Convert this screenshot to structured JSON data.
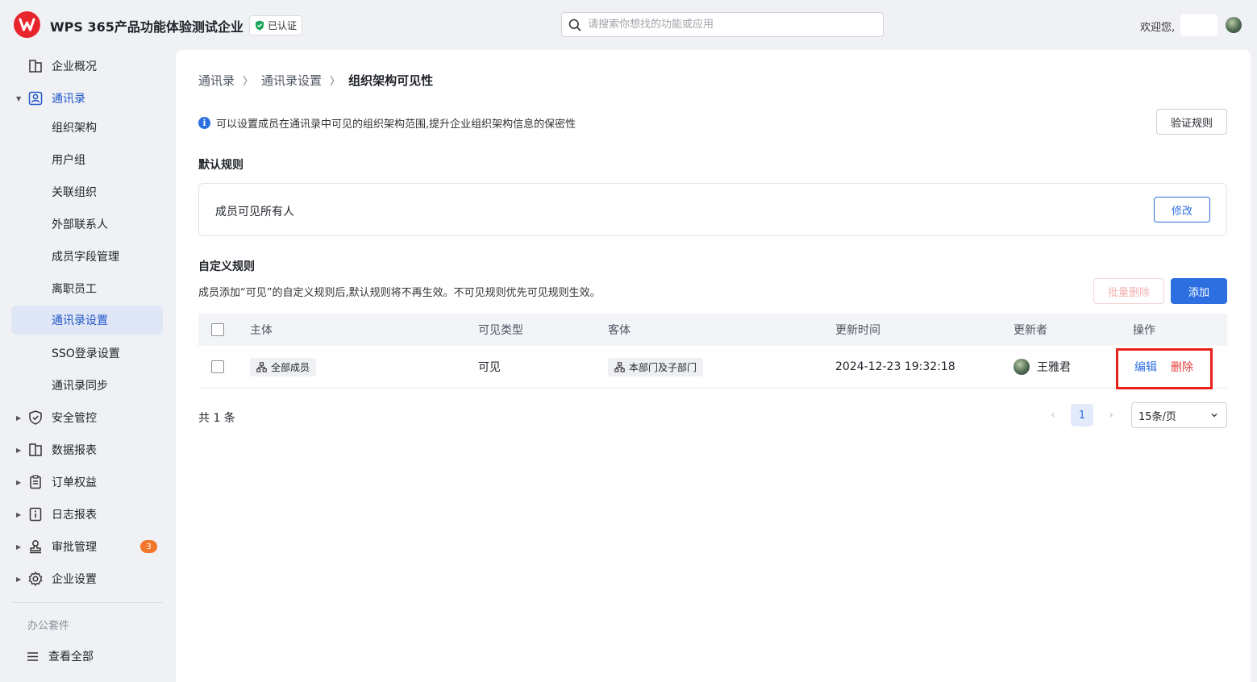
{
  "header": {
    "org_name": "WPS 365产品功能体验测试企业",
    "verified_label": "已认证",
    "search_placeholder": "请搜索你想找的功能或应用",
    "welcome": "欢迎您,"
  },
  "sidebar": {
    "items": [
      {
        "label": "企业概况",
        "icon": "building-icon"
      },
      {
        "label": "通讯录",
        "icon": "contacts-icon"
      },
      {
        "label": "组织架构"
      },
      {
        "label": "用户组"
      },
      {
        "label": "关联组织"
      },
      {
        "label": "外部联系人"
      },
      {
        "label": "成员字段管理"
      },
      {
        "label": "离职员工"
      },
      {
        "label": "通讯录设置"
      },
      {
        "label": "SSO登录设置"
      },
      {
        "label": "通讯录同步"
      },
      {
        "label": "安全管控",
        "icon": "shield-icon"
      },
      {
        "label": "数据报表",
        "icon": "book-icon"
      },
      {
        "label": "订单权益",
        "icon": "clipboard-icon"
      },
      {
        "label": "日志报表",
        "icon": "info-doc-icon"
      },
      {
        "label": "审批管理",
        "icon": "stamp-icon",
        "badge": "3"
      },
      {
        "label": "企业设置",
        "icon": "gear-icon"
      }
    ],
    "suite_title": "办公套件",
    "view_all": "查看全部"
  },
  "breadcrumb": {
    "level1": "通讯录",
    "level2": "通讯录设置",
    "current": "组织架构可见性"
  },
  "info_text": "可以设置成员在通讯录中可见的组织架构范围,提升企业组织架构信息的保密性",
  "verify_button": "验证规则",
  "default_rule": {
    "title": "默认规则",
    "text": "成员可见所有人",
    "edit_button": "修改"
  },
  "custom_rules": {
    "title": "自定义规则",
    "description": "成员添加“可见”的自定义规则后,默认规则将不再生效。不可见规则优先可见规则生效。",
    "batch_delete": "批量删除",
    "add": "添加",
    "columns": [
      "主体",
      "可见类型",
      "客体",
      "更新时间",
      "更新者",
      "操作"
    ],
    "rows": [
      {
        "subject": "全部成员",
        "visibility": "可见",
        "object": "本部门及子部门",
        "updated_at": "2024-12-23 19:32:18",
        "updater": "王雅君",
        "edit": "编辑",
        "delete": "删除"
      }
    ]
  },
  "pagination": {
    "total": "共 1 条",
    "page": "1",
    "page_size": "15条/页"
  },
  "colors": {
    "accent": "#2d6fe0",
    "danger": "#e03b3b",
    "brand": "#e8252d",
    "highlight": "#e8201a"
  }
}
